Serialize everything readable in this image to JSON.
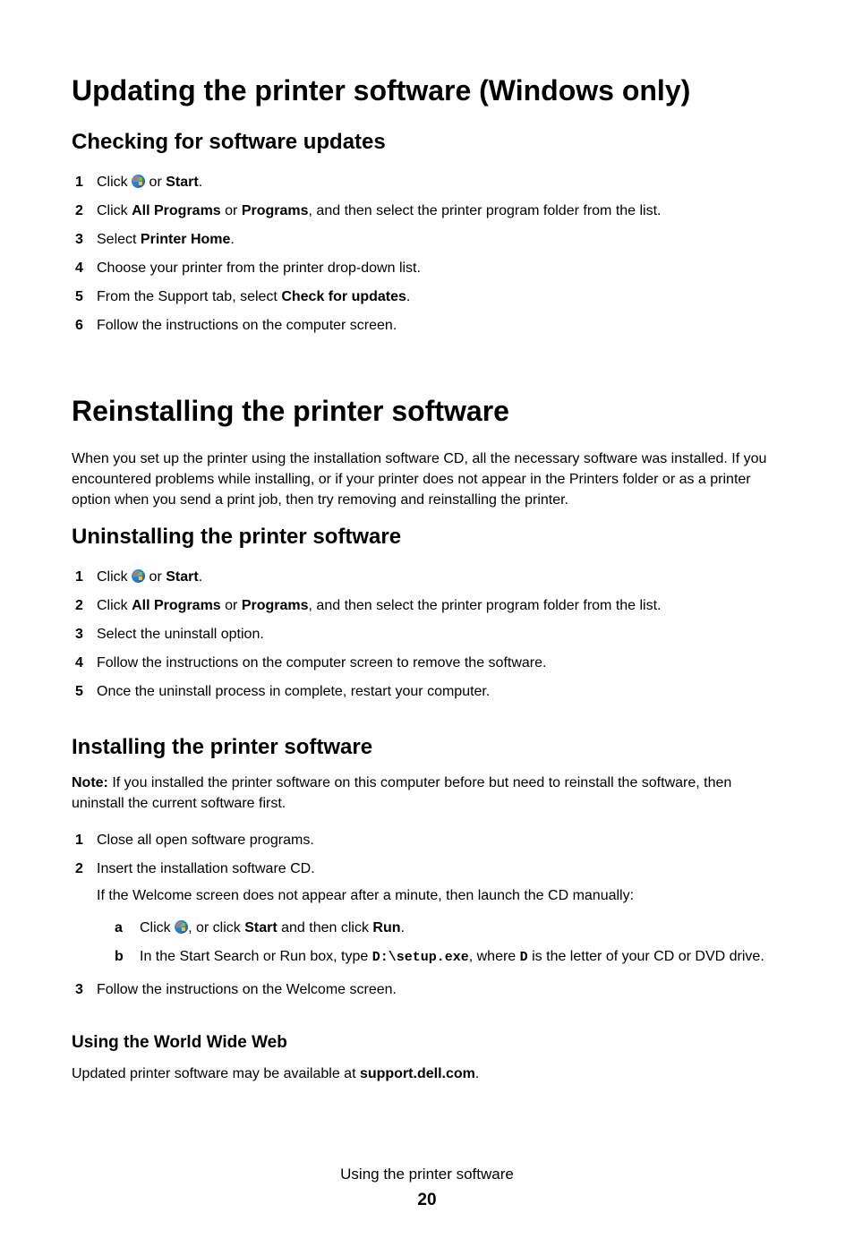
{
  "h1_updating": "Updating the printer software (Windows only)",
  "h2_checking": "Checking for software updates",
  "checking_steps": {
    "s1_a": "Click ",
    "s1_b": " or ",
    "s1_start": "Start",
    "s1_c": ".",
    "s2_a": "Click ",
    "s2_allprograms": "All Programs",
    "s2_b": " or ",
    "s2_programs": "Programs",
    "s2_c": ", and then select the printer program folder from the list.",
    "s3_a": "Select ",
    "s3_printerhome": "Printer Home",
    "s3_b": ".",
    "s4": "Choose your printer from the printer drop-down list.",
    "s5_a": "From the Support tab, select ",
    "s5_check": "Check for updates",
    "s5_b": ".",
    "s6": "Follow the instructions on the computer screen."
  },
  "h1_reinstalling": "Reinstalling the printer software",
  "reinstalling_intro": "When you set up the printer using the installation software CD, all the necessary software was installed. If you encountered problems while installing, or if your printer does not appear in the Printers folder or as a printer option when you send a print job, then try removing and reinstalling the printer.",
  "h2_uninstalling": "Uninstalling the printer software",
  "uninstall_steps": {
    "s1_a": "Click ",
    "s1_b": " or ",
    "s1_start": "Start",
    "s1_c": ".",
    "s2_a": "Click ",
    "s2_allprograms": "All Programs",
    "s2_b": " or ",
    "s2_programs": "Programs",
    "s2_c": ", and then select the printer program folder from the list.",
    "s3": "Select the uninstall option.",
    "s4": "Follow the instructions on the computer screen to remove the software.",
    "s5": "Once the uninstall process in complete, restart your computer."
  },
  "h2_installing": "Installing the printer software",
  "note_label": "Note:",
  "note_text": " If you installed the printer software on this computer before but need to reinstall the software, then uninstall the current software first.",
  "install_steps": {
    "s1": "Close all open software programs.",
    "s2": "Insert the installation software CD.",
    "s2_sub": "If the Welcome screen does not appear after a minute, then launch the CD manually:",
    "sa_a": "Click ",
    "sa_b": ", or click ",
    "sa_start": "Start",
    "sa_c": " and then click ",
    "sa_run": "Run",
    "sa_d": ".",
    "sb_a": "In the Start Search or Run box, type ",
    "sb_code": "D:\\setup.exe",
    "sb_b": ", where ",
    "sb_d": "D",
    "sb_c": " is the letter of your CD or DVD drive.",
    "s3": "Follow the instructions on the Welcome screen."
  },
  "h3_www": "Using the World Wide Web",
  "www_a": "Updated printer software may be available at ",
  "www_link": "support.dell.com",
  "www_b": ".",
  "footer_title": "Using the printer software",
  "footer_page": "20"
}
